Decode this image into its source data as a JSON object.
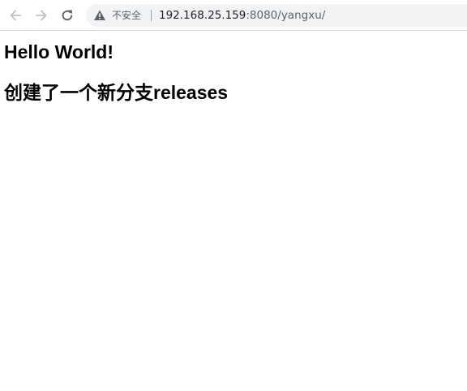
{
  "browser": {
    "security_label": "不安全",
    "url_host": "192.168.25.159",
    "url_rest": ":8080/yangxu/",
    "icons": {
      "back": "arrow-left-icon",
      "forward": "arrow-right-icon",
      "reload": "reload-icon",
      "warning": "warning-triangle-icon"
    }
  },
  "page": {
    "heading_1": "Hello World!",
    "heading_2": "创建了一个新分支releases"
  }
}
